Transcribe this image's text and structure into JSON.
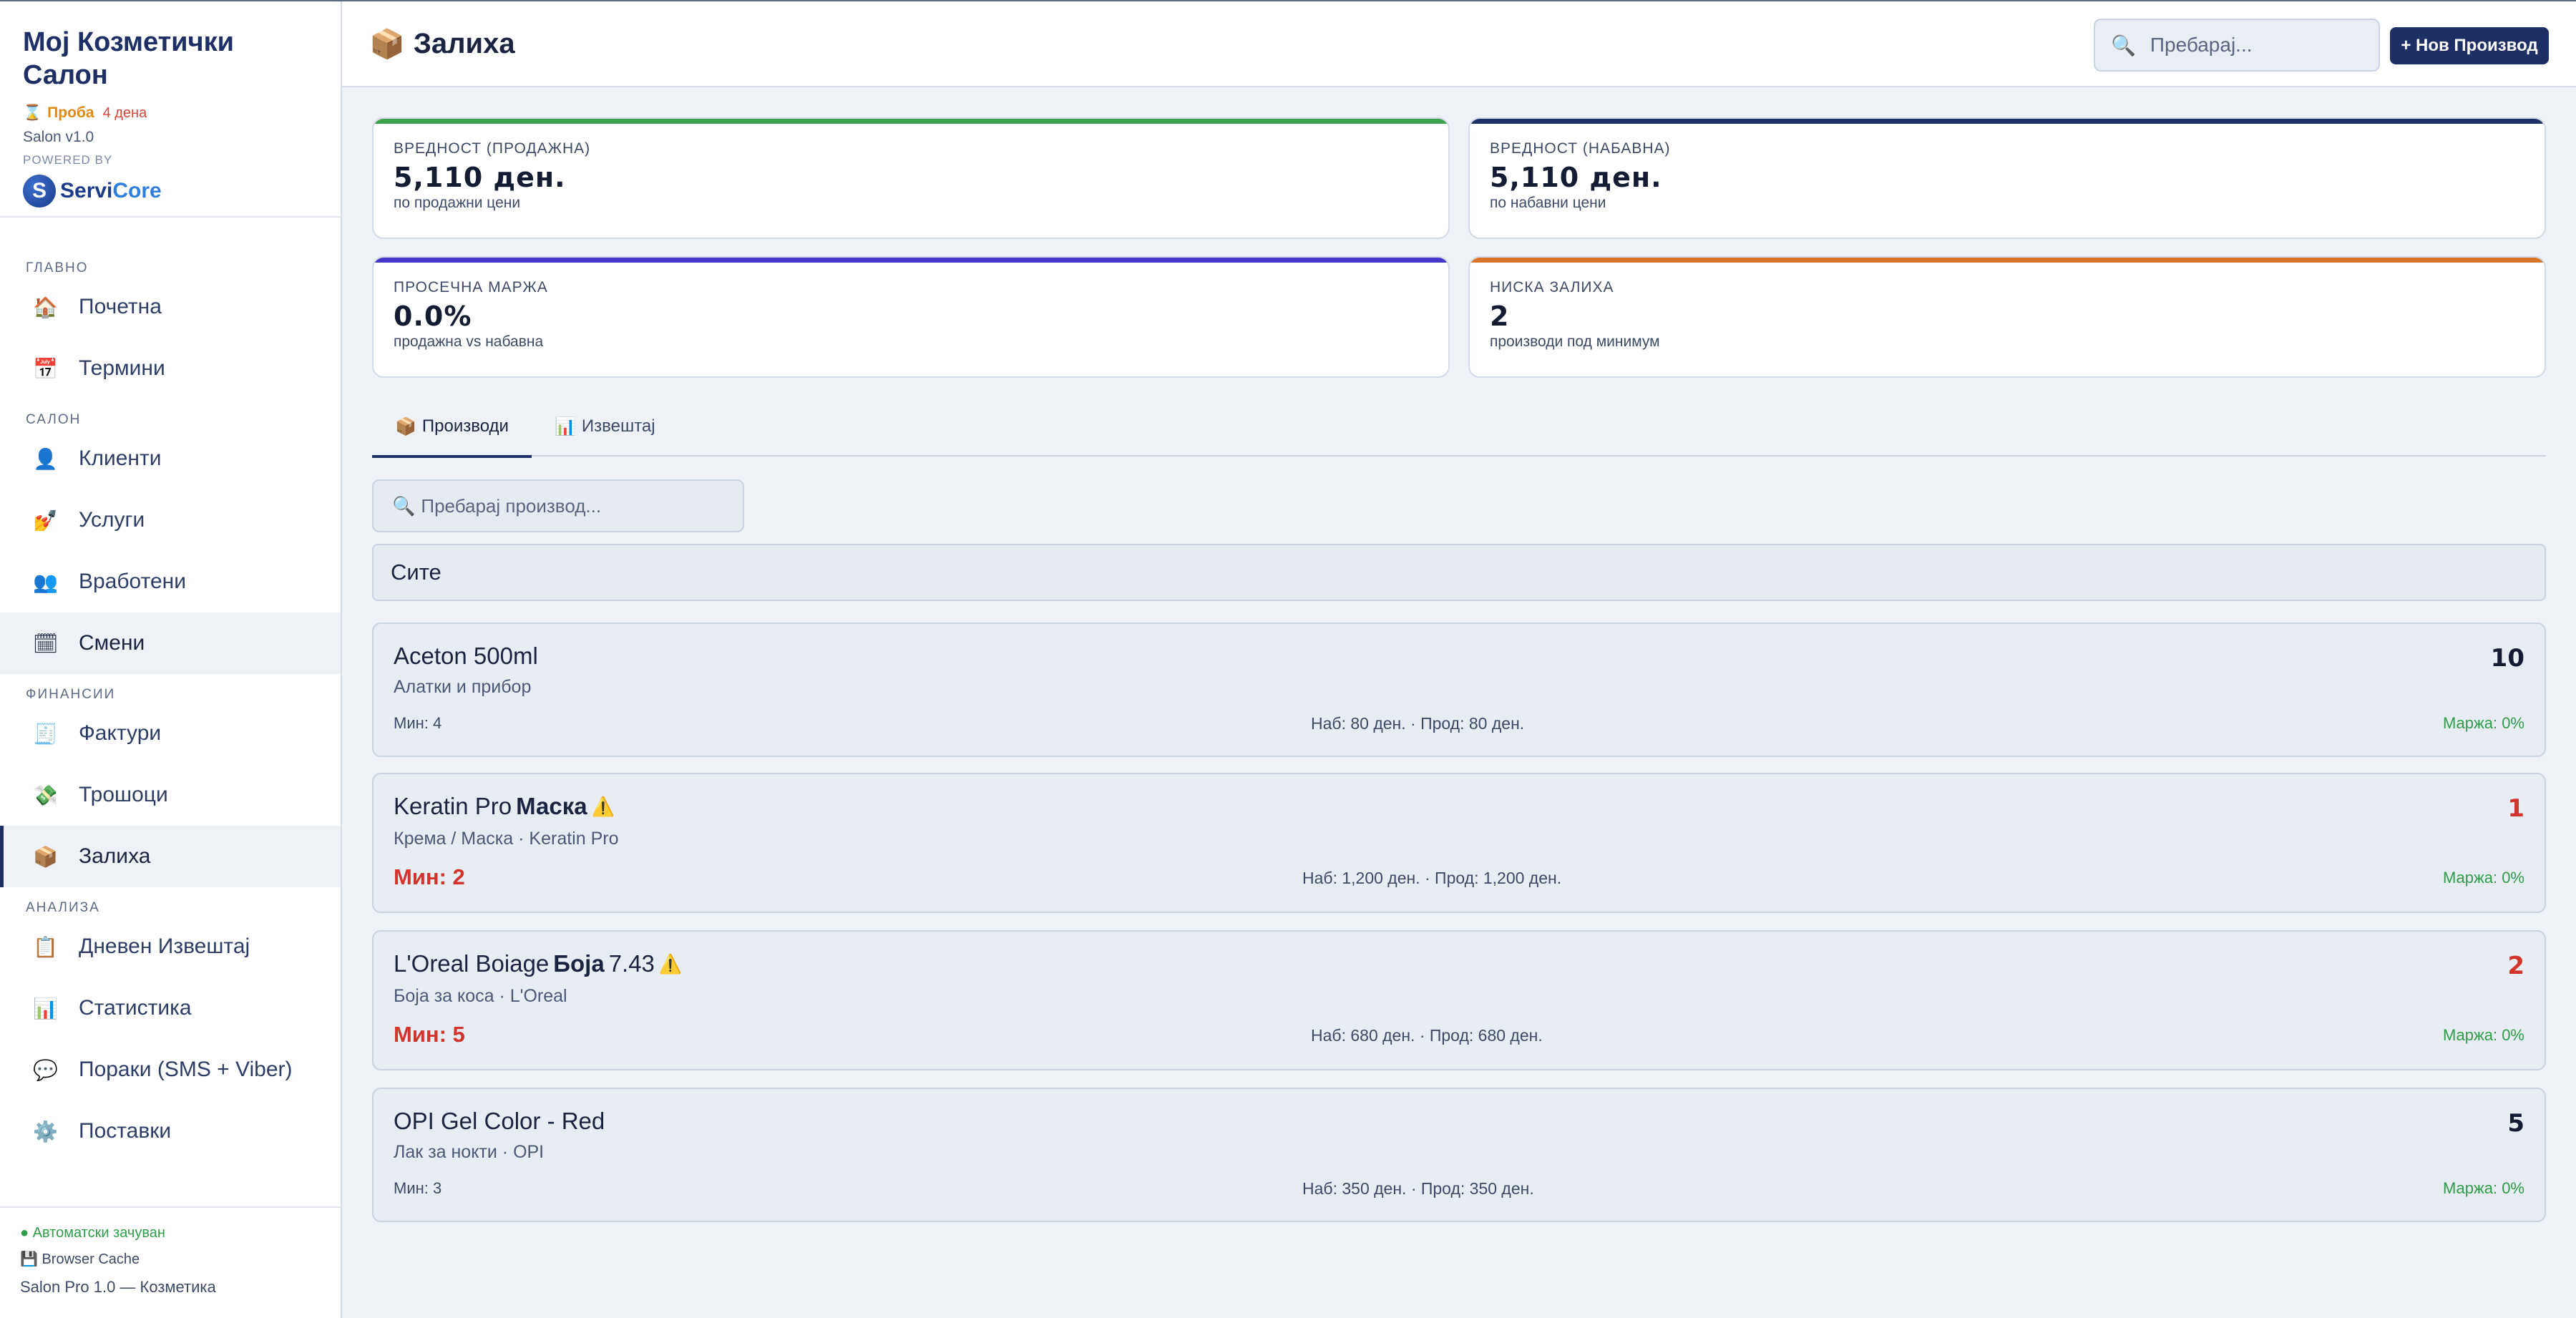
{
  "sidebar": {
    "brand_title": "Мој Козметички Салон",
    "trial_icon": "⌛",
    "trial_label": "Проба",
    "trial_days": "4 дена",
    "version": "Salon v1.0",
    "powered_by": "POWERED BY",
    "logo_letter": "S",
    "logo_text_a": "Servi",
    "logo_text_b": "Core",
    "sections": {
      "main": "ГЛАВНО",
      "salon": "САЛОН",
      "finance": "ФИНАНСИИ",
      "analysis": "АНАЛИЗА"
    },
    "items": {
      "home": {
        "icon": "🏠",
        "label": "Почетна"
      },
      "appointments": {
        "icon": "📅",
        "label": "Термини"
      },
      "clients": {
        "icon": "👤",
        "label": "Клиенти"
      },
      "services": {
        "icon": "💅",
        "label": "Услуги"
      },
      "employees": {
        "icon": "👥",
        "label": "Вработени"
      },
      "shifts": {
        "icon": "🗓",
        "label": "Смени"
      },
      "invoices": {
        "icon": "🧾",
        "label": "Фактури"
      },
      "expenses": {
        "icon": "💸",
        "label": "Трошоци"
      },
      "inventory": {
        "icon": "📦",
        "label": "Залиха"
      },
      "daily_report": {
        "icon": "📋",
        "label": "Дневен Извештај"
      },
      "statistics": {
        "icon": "📊",
        "label": "Статистика"
      },
      "messages": {
        "icon": "💬",
        "label": "Пораки (SMS + Viber)"
      },
      "settings": {
        "icon": "⚙️",
        "label": "Поставки"
      }
    },
    "footer": {
      "autosave": "● Автоматски зачуван",
      "cache": "💾 Browser Cache",
      "version": "Salon Pro 1.0 — Козметика"
    }
  },
  "header": {
    "title_icon": "📦",
    "title": "Залиха",
    "search_placeholder": "Пребарај...",
    "search_icon": "🔍",
    "new_button": "+ Нов Производ"
  },
  "stats": [
    {
      "label": "ВРЕДНОСТ (ПРОДАЖНА)",
      "value": "5,110 ден.",
      "sub": "по продажни цени",
      "color": "#3aa14c"
    },
    {
      "label": "ВРЕДНОСТ (НАБАВНА)",
      "value": "5,110 ден.",
      "sub": "по набавни цени",
      "color": "#1e2f66"
    },
    {
      "label": "ПРОСЕЧНА МАРЖА",
      "value": "0.0%",
      "sub": "продажна vs набавна",
      "color": "#4338ca"
    },
    {
      "label": "НИСКА ЗАЛИХА",
      "value": "2",
      "sub": "производи под минимум",
      "color": "#d9742a"
    }
  ],
  "tabs": {
    "products": {
      "icon": "📦",
      "label": "Производи"
    },
    "report": {
      "icon": "📊",
      "label": "Извештај"
    }
  },
  "product_search": {
    "icon": "🔍",
    "placeholder": "Пребарај производ..."
  },
  "category_filter": "Сите",
  "products": [
    {
      "name_a": "Aceton 500ml",
      "name_b": "",
      "name_c": "",
      "warning": "",
      "category": "Алатки и прибор",
      "min": "Мин: 4",
      "prices": "Наб: 80 ден. · Прод: 80 ден.",
      "margin": "Маржа: 0%",
      "qty": "10"
    },
    {
      "name_a": "Keratin Pro ",
      "name_b": "Маска",
      "name_c": "",
      "warning": "⚠️",
      "category": "Крема / Маска · Keratin Pro",
      "min": "Мин: 2",
      "prices": "Наб: 1,200 ден. · Прод: 1,200 ден.",
      "margin": "Маржа: 0%",
      "qty": "1"
    },
    {
      "name_a": "L'Oreal Boiage ",
      "name_b": "Боја",
      "name_c": " 7.43",
      "warning": "⚠️",
      "category": "Боја за коса · L'Oreal",
      "min": "Мин: 5",
      "prices": "Наб: 680 ден. · Прод: 680 ден.",
      "margin": "Маржа: 0%",
      "qty": "2"
    },
    {
      "name_a": "OPI Gel Color - Red",
      "name_b": "",
      "name_c": "",
      "warning": "",
      "category": "Лак за нокти · OPI",
      "min": "Мин: 3",
      "prices": "Наб: 350 ден. · Прод: 350 ден.",
      "margin": "Маржа: 0%",
      "qty": "5"
    }
  ]
}
